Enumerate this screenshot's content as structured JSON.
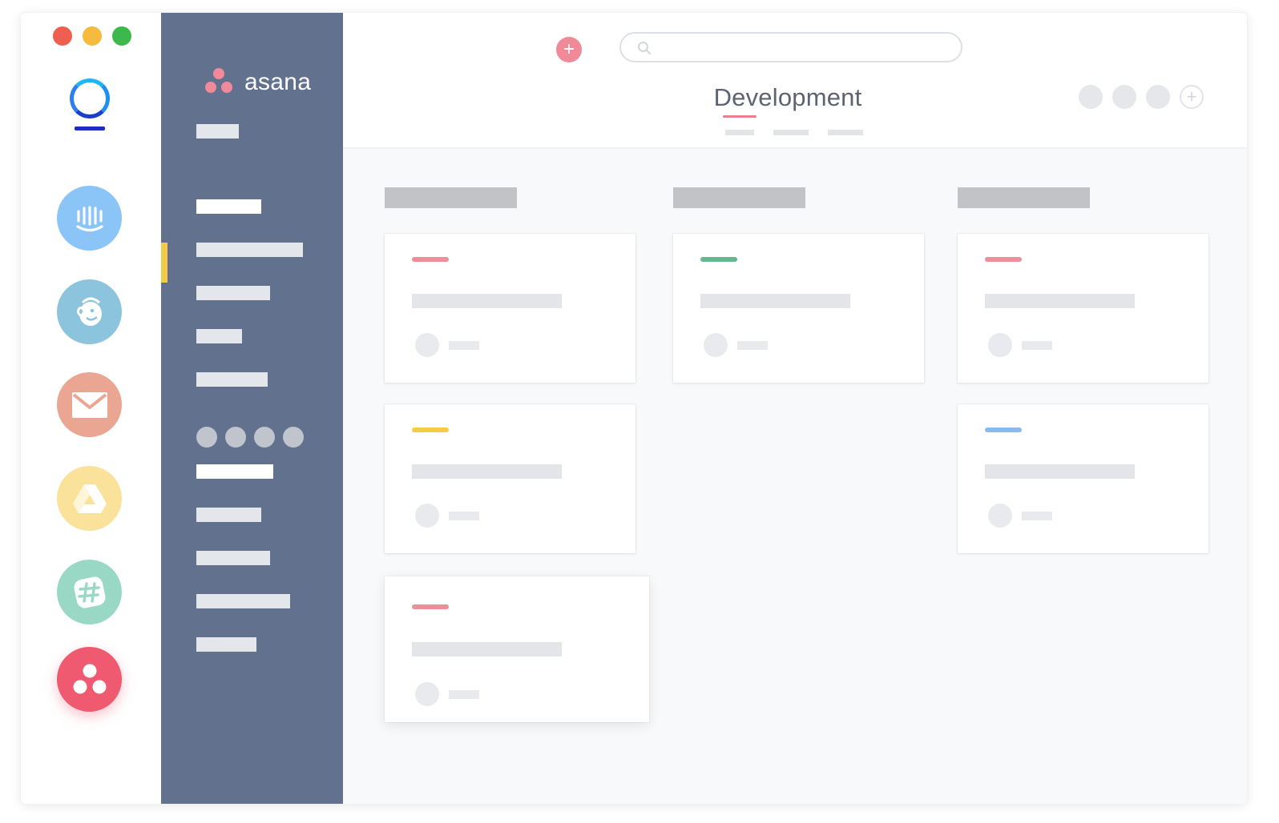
{
  "window": {
    "traffic_lights": [
      {
        "name": "close",
        "color": "#ef5f4f"
      },
      {
        "name": "minimize",
        "color": "#f6bb3c"
      },
      {
        "name": "maximize",
        "color": "#3cb94a"
      }
    ]
  },
  "dock": {
    "logo_icon": "ring-logo-icon",
    "apps": [
      {
        "id": "intercom",
        "icon": "intercom-icon",
        "color": "#8bc4f7",
        "active": false
      },
      {
        "id": "mailchimp",
        "icon": "mailchimp-icon",
        "color": "#8dc4dd",
        "active": false
      },
      {
        "id": "gmail",
        "icon": "mail-icon",
        "color": "#eaa593",
        "active": false
      },
      {
        "id": "drive",
        "icon": "drive-icon",
        "color": "#fae29b",
        "active": false
      },
      {
        "id": "slack",
        "icon": "slack-icon",
        "color": "#9ad8c6",
        "active": false
      },
      {
        "id": "asana",
        "icon": "asana-icon",
        "color": "#ef5a70",
        "active": true
      }
    ]
  },
  "sidebar": {
    "brand": "asana",
    "brand_icon": "asana-logo-icon",
    "accent_color": "#f5c94a",
    "background": "#61718e"
  },
  "header": {
    "title": "Development",
    "add_icon": "plus-icon",
    "search_icon": "search-icon",
    "title_accent": "#e8808f"
  },
  "board": {
    "columns": [
      {
        "cards": [
          {
            "tag_color": "#ee8e98"
          },
          {
            "tag_color": "#f7cc45"
          },
          {
            "tag_color": "#ee8e98"
          }
        ]
      },
      {
        "cards": [
          {
            "tag_color": "#63b890"
          }
        ]
      },
      {
        "cards": [
          {
            "tag_color": "#ee8e98"
          },
          {
            "tag_color": "#8bbaf1"
          }
        ]
      }
    ]
  }
}
